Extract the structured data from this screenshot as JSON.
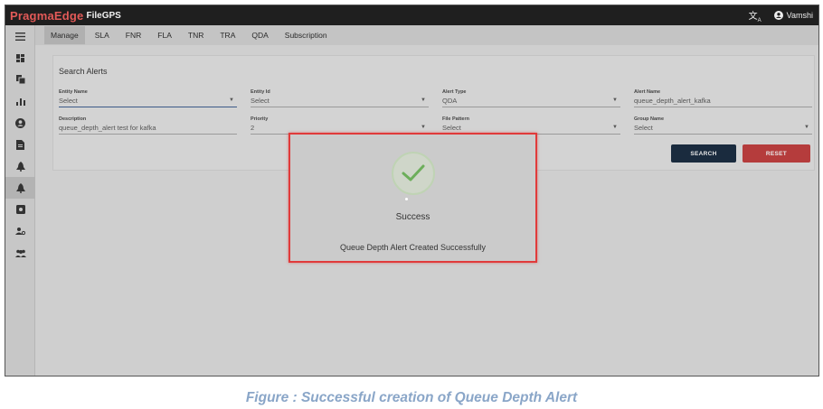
{
  "topbar": {
    "brand": "PragmaEdge",
    "product": "FileGPS",
    "translate_icon": "translate-icon",
    "user_icon": "account-circle-icon",
    "user_name": "Vamshi"
  },
  "sidebar": {
    "items": [
      {
        "icon": "menu-icon",
        "glyph": "☰"
      },
      {
        "icon": "dashboard-icon",
        "glyph": "▪"
      },
      {
        "icon": "copy-icon",
        "glyph": "❐"
      },
      {
        "icon": "bar-chart-icon",
        "glyph": "ıl"
      },
      {
        "icon": "user-icon",
        "glyph": "●"
      },
      {
        "icon": "document-icon",
        "glyph": "▮"
      },
      {
        "icon": "alert-icon",
        "glyph": "▲"
      },
      {
        "icon": "alert-active-icon",
        "glyph": "▲"
      },
      {
        "icon": "settings-icon",
        "glyph": "▣"
      },
      {
        "icon": "user-settings-icon",
        "glyph": "⚙"
      },
      {
        "icon": "group-icon",
        "glyph": "👥"
      }
    ]
  },
  "tabs": [
    "Manage",
    "SLA",
    "FNR",
    "FLA",
    "TNR",
    "TRA",
    "QDA",
    "Subscription"
  ],
  "search": {
    "title": "Search Alerts",
    "fields": [
      {
        "label": "Entity Name",
        "value": "Select"
      },
      {
        "label": "Entity Id",
        "value": "Select"
      },
      {
        "label": "Alert Type",
        "value": "QDA"
      },
      {
        "label": "Alert Name",
        "value": "queue_depth_alert_kafka"
      },
      {
        "label": "Description",
        "value": "queue_depth_alert test for kafka"
      },
      {
        "label": "Priority",
        "value": "2"
      },
      {
        "label": "File Pattern",
        "value": "Select"
      },
      {
        "label": "Group Name",
        "value": "Select"
      }
    ],
    "search_button": "SEARCH",
    "reset_button": "RESET"
  },
  "modal": {
    "title": "Success",
    "message": "Queue Depth Alert Created Successfully",
    "icon": "check-circle-icon",
    "border_color": "#e03a3a"
  },
  "caption": "Figure : Successful creation of Queue Depth Alert"
}
